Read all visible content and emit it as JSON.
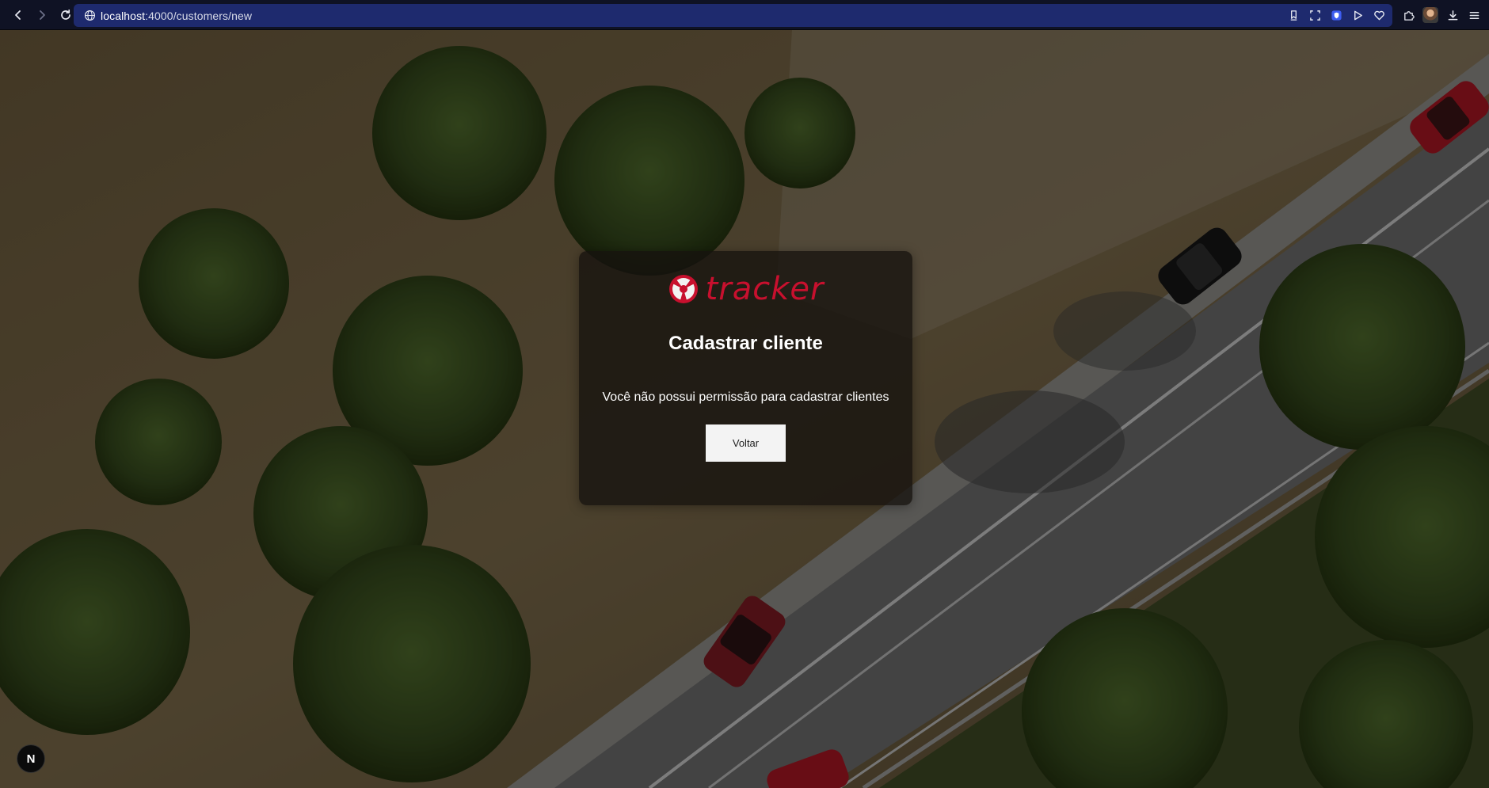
{
  "browser": {
    "url_host": "localhost",
    "url_path": ":4000/customers/new",
    "icons": [
      "back-icon",
      "forward-icon",
      "reload-icon",
      "site-info-icon",
      "bookmark-icon",
      "screenshot-icon",
      "shield-icon",
      "play-icon",
      "heart-icon",
      "extensions-icon",
      "profile-avatar",
      "download-icon",
      "menu-icon"
    ]
  },
  "brand": {
    "name": "tracker",
    "color": "#c8102e"
  },
  "card": {
    "title": "Cadastrar cliente",
    "message": "Você não possui permissão para cadastrar clientes",
    "back_button_label": "Voltar"
  },
  "dev_badge": {
    "label": "N"
  }
}
